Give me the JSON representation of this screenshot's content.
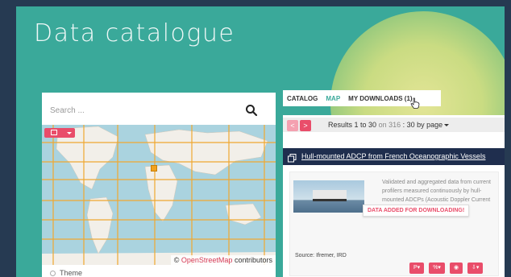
{
  "page": {
    "title": "Data catalogue"
  },
  "search": {
    "placeholder": "Search ..."
  },
  "map": {
    "attribution_prefix": "©",
    "attribution_link": "OpenStreetMap",
    "attribution_suffix": "contributors"
  },
  "filters": {
    "theme_label": "Theme"
  },
  "tabs": [
    {
      "label": "CATALOG"
    },
    {
      "label": "MAP"
    },
    {
      "label": "MY DOWNLOADS (1)"
    }
  ],
  "pagination": {
    "prev": "<",
    "next": ">",
    "results_prefix": "Results 1 to 30",
    "results_on": "on 316",
    "results_suffix": ": 30 by page"
  },
  "record": {
    "title": "Hull-mounted ADCP from French Oceanographic Vessels",
    "description": "Validated and aggregated data from current profilers measured continuously by hull-mounted ADCPs (Acoustic Doppler Current",
    "badge": "DATA ADDED FOR DOWNLOADING!",
    "source": "Source: Ifremer, IRD",
    "actions": [
      "P▾",
      "%▾",
      "◉",
      "⇩▾"
    ]
  },
  "colors": {
    "background": "#263a52",
    "banner": "#3aa99a",
    "accent": "#e94d6a",
    "record_header": "#1f2e4e",
    "highlight": "#e6e690"
  }
}
